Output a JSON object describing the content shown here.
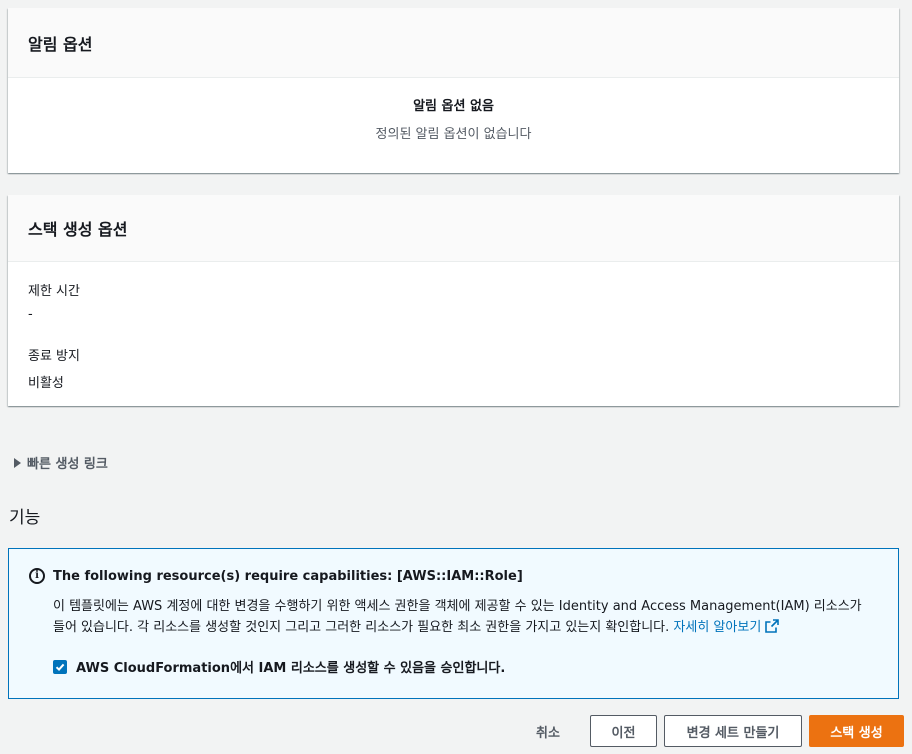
{
  "notification_options": {
    "title": "알림 옵션",
    "empty_title": "알림 옵션 없음",
    "empty_description": "정의된 알림 옵션이 없습니다"
  },
  "stack_creation_options": {
    "title": "스택 생성 옵션",
    "fields": [
      {
        "label": "제한 시간",
        "value": "-"
      },
      {
        "label": "종료 방지",
        "value": "비활성"
      }
    ]
  },
  "quick_create_link": {
    "label": "빠른 생성 링크",
    "icon": "caret-right-icon"
  },
  "capabilities": {
    "heading": "기능",
    "info_icon": "info-icon",
    "title": "The following resource(s) require capabilities: [AWS::IAM::Role]",
    "body": "이 템플릿에는 AWS 계정에 대한 변경을 수행하기 위한 액세스 권한을 객체에 제공할 수 있는 Identity and Access Management(IAM) 리소스가 들어 있습니다. 각 리소스를 생성할 것인지 그리고 그러한 리소스가 필요한 최소 권한을 가지고 있는지 확인합니다.",
    "learn_more": "자세히 알아보기",
    "acknowledge_label": "AWS CloudFormation에서 IAM 리소스를 생성할 수 있음을 승인합니다.",
    "acknowledged": true
  },
  "actions": {
    "cancel": "취소",
    "previous": "이전",
    "create_change_set": "변경 세트 만들기",
    "create_stack": "스택 생성"
  },
  "colors": {
    "primary": "#ec7211",
    "link": "#0073bb",
    "info_background": "#f1faff",
    "page_background": "#f2f3f3"
  }
}
